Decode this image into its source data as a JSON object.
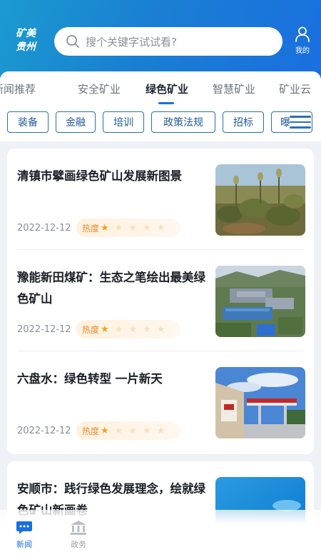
{
  "header": {
    "logo_line1": "矿美",
    "logo_line2": "贵州",
    "search_placeholder": "搜个关键字试试看?",
    "mine_label": "我的",
    "accent": "#1a6fe0"
  },
  "tabs": [
    "新闻",
    "推荐",
    "安全矿业",
    "绿色矿业",
    "智慧矿业",
    "矿业云"
  ],
  "active_tab": "绿色矿业",
  "categories": [
    "装备",
    "金融",
    "培训",
    "政策法规",
    "招标",
    "曝光"
  ],
  "hot_label": "热度",
  "news": [
    {
      "title": "清镇市擘画绿色矿山发展新图景",
      "date": "2022-12-12",
      "rating": 1,
      "max_rating": 5,
      "thumb_icon": "hillside-shrubs-image"
    },
    {
      "title": "豫能新田煤矿：生态之笔绘出最美绿色矿山",
      "date": "2022-12-12",
      "rating": 1,
      "max_rating": 5,
      "thumb_icon": "mine-aerial-image"
    },
    {
      "title": "六盘水：绿色转型 一片新天",
      "date": "2022-12-12",
      "rating": 1,
      "max_rating": 5,
      "thumb_icon": "gas-station-image"
    },
    {
      "title": "安顺市：践行绿色发展理念，绘就绿色矿山新画卷",
      "date": "",
      "rating": 0,
      "max_rating": 5,
      "thumb_icon": "blue-sky-image"
    }
  ],
  "bottom_nav": [
    {
      "label": "新闻",
      "icon": "chat-bubble-icon",
      "active": true
    },
    {
      "label": "政务",
      "icon": "government-building-icon",
      "active": false
    }
  ]
}
